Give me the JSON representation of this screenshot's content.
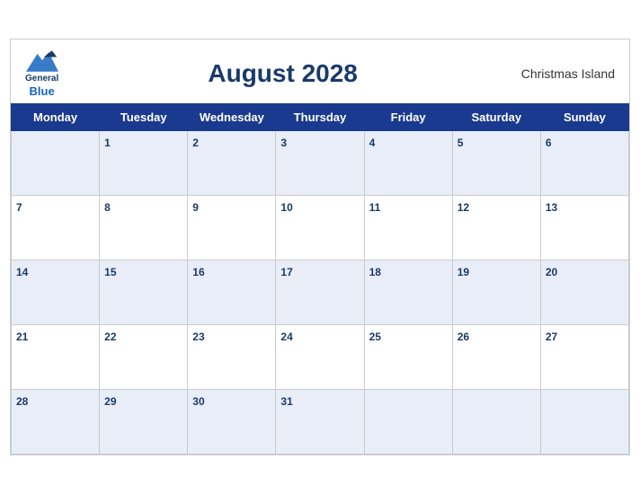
{
  "header": {
    "logo": {
      "general": "General",
      "blue": "Blue"
    },
    "title": "August 2028",
    "region": "Christmas Island"
  },
  "weekdays": [
    "Monday",
    "Tuesday",
    "Wednesday",
    "Thursday",
    "Friday",
    "Saturday",
    "Sunday"
  ],
  "weeks": [
    [
      null,
      1,
      2,
      3,
      4,
      5,
      6
    ],
    [
      7,
      8,
      9,
      10,
      11,
      12,
      13
    ],
    [
      14,
      15,
      16,
      17,
      18,
      19,
      20
    ],
    [
      21,
      22,
      23,
      24,
      25,
      26,
      27
    ],
    [
      28,
      29,
      30,
      31,
      null,
      null,
      null
    ]
  ]
}
